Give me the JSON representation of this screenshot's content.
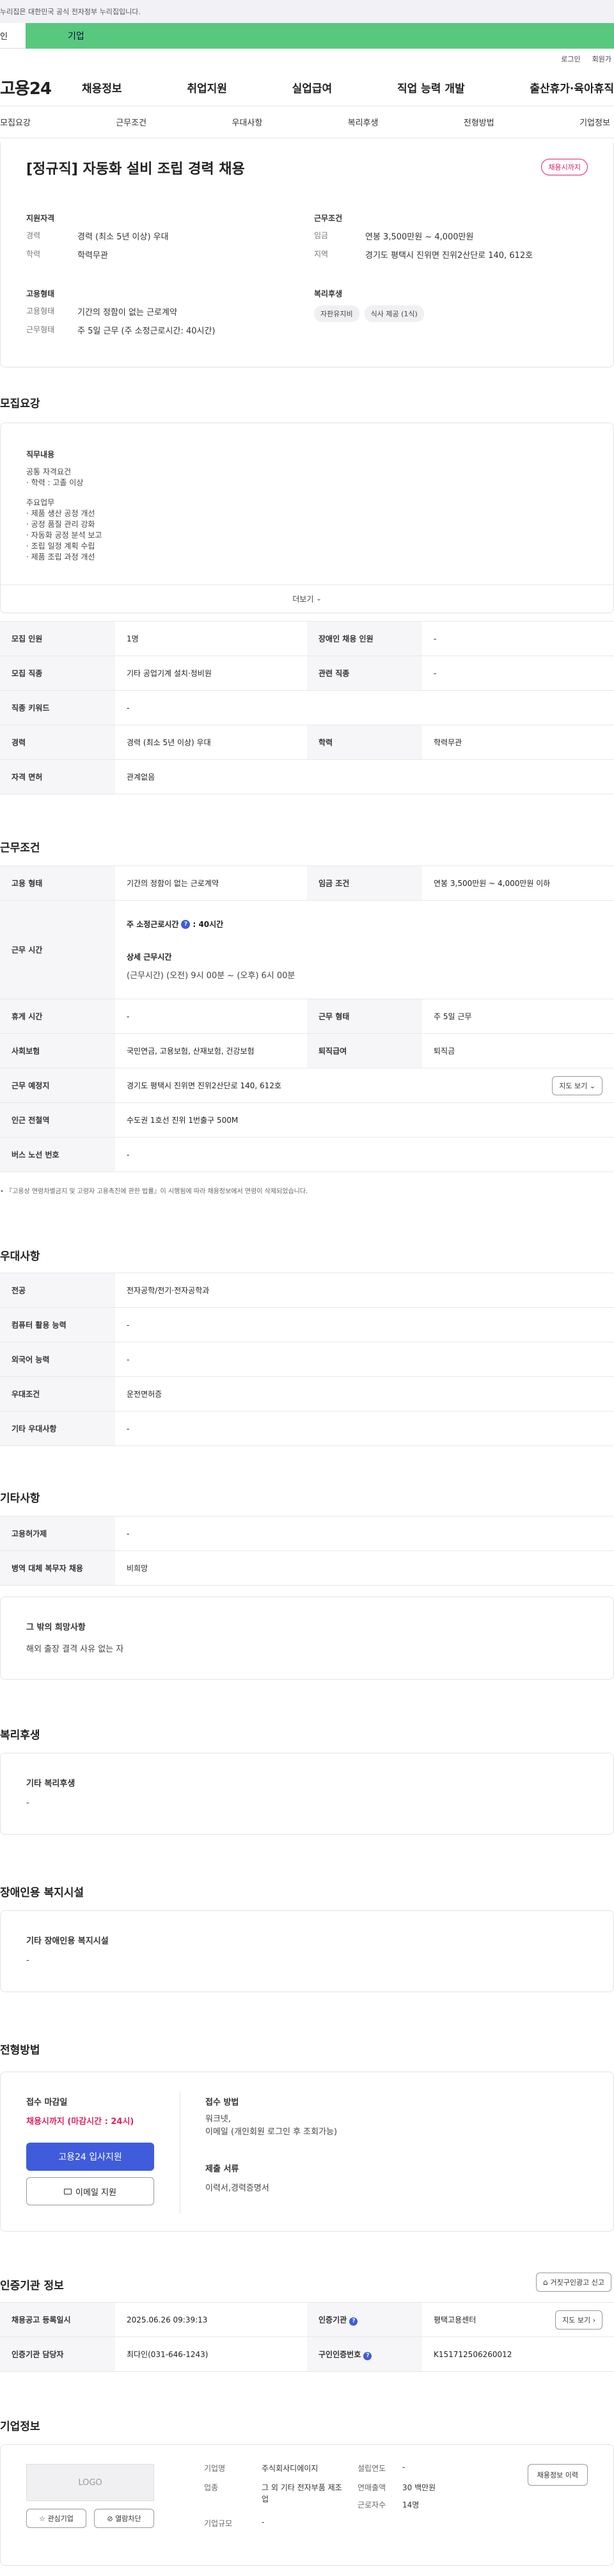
{
  "gov_notice": "누리집은 대한민국 공식 전자정부 누리집입니다.",
  "tabs": {
    "individual": "인",
    "business": "기업"
  },
  "util": {
    "login": "로그인",
    "signup": "회원가"
  },
  "logo": "고용24",
  "gnb": [
    "채용정보",
    "취업지원",
    "실업급여",
    "직업 능력 개발",
    "출산휴가·육아휴직"
  ],
  "subnav": [
    "모집요강",
    "근무조건",
    "우대사항",
    "복리후생",
    "전형방법",
    "기업정보"
  ],
  "job": {
    "title": "[정규직] 자동화 설비 조립 경력 채용",
    "deadline_badge": "채용시까지",
    "qual_title": "지원자격",
    "qual": [
      {
        "k": "경력",
        "v": "경력 (최소 5년 이상) 우대"
      },
      {
        "k": "학력",
        "v": "학력무관"
      }
    ],
    "cond_title": "근무조건",
    "cond": [
      {
        "k": "임금",
        "v": "연봉 3,500만원 ~ 4,000만원"
      },
      {
        "k": "지역",
        "v": "경기도 평택시 진위면 진위2산단로 140, 612호"
      }
    ],
    "emp_title": "고용형태",
    "emp": [
      {
        "k": "고용형태",
        "v": "기간의 정함이 없는 근로계약"
      },
      {
        "k": "근무형태",
        "v": "주 5일 근무 (주 소정근로시간: 40시간)"
      }
    ],
    "welfare_title": "복리후생",
    "welfare_chips": [
      "자판유지비",
      "식사 제공 (1식)"
    ]
  },
  "recruit": {
    "section": "모집요강",
    "duty_title": "직무내용",
    "duty_lines": [
      "공통 자격요건",
      "· 학력 : 고졸 이상",
      "",
      "주요업무",
      "· 제품 생산 공정 개선",
      "· 공정 품질 관리 강화",
      "· 자동화 공정 분석 보고",
      "· 조립 일정 계획 수립",
      "· 제품 조립 과정 개선"
    ],
    "more": "더보기",
    "rows": [
      [
        "모집 인원",
        "1명",
        "장애인 채용 인원",
        "-"
      ],
      [
        "모집 직종",
        "기타 공업기계 설치·정비원",
        "관련 직종",
        "-"
      ],
      [
        "직종 키워드",
        "-",
        "",
        ""
      ],
      [
        "경력",
        "경력 (최소 5년 이상) 우대",
        "학력",
        "학력무관"
      ],
      [
        "자격 면허",
        "관계없음",
        "",
        ""
      ]
    ]
  },
  "work": {
    "section": "근무조건",
    "emp_type_h": "고용 형태",
    "emp_type": "기간의 정함이 없는 근로계약",
    "wage_h": "임금 조건",
    "wage": "연봉 3,500만원 ~ 4,000만원 이하",
    "hours_h": "근무 시간",
    "hours_main": "주 소정근로시간",
    "hours_main_val": ": 40시간",
    "hours_detail_title": "상세 근무시간",
    "hours_detail": "(근무시간) (오전) 9시 00분 ~ (오후) 6시 00분",
    "rest_h": "휴게 시간",
    "rest": "-",
    "form_h": "근무 형태",
    "form": "주 5일 근무",
    "ins_h": "사회보험",
    "ins": "국민연금, 고용보험, 산재보험, 건강보험",
    "sev_h": "퇴직급여",
    "sev": "퇴직금",
    "place_h": "근무 예정지",
    "place": "경기도 평택시 진위면 진위2산단로 140, 612호",
    "map_btn": "지도 보기",
    "subway_h": "인근 전철역",
    "subway": "수도권 1호선 진위 1번출구 500M",
    "bus_h": "버스 노선 번호",
    "bus": "-",
    "note": "『고용상 연령차별금지 및 고령자 고용촉진에 관한 법률』이 시행됨에 따라 채용정보에서 연령이 삭제되었습니다."
  },
  "pref": {
    "section": "우대사항",
    "rows": [
      [
        "전공",
        "전자공학/전기·전자공학과"
      ],
      [
        "컴퓨터 활용 능력",
        "-"
      ],
      [
        "외국어 능력",
        "-"
      ],
      [
        "우대조건",
        "운전면허증"
      ],
      [
        "기타 우대사항",
        "-"
      ]
    ]
  },
  "etc": {
    "section": "기타사항",
    "rows": [
      [
        "고용허가제",
        "-"
      ],
      [
        "병역 대체 복무자 채용",
        "비희망"
      ]
    ],
    "hope_title": "그 밖의 희망사항",
    "hope_text": "해외 출장 결격 사유 없는 자"
  },
  "benefit": {
    "section": "복리후생",
    "title": "기타 복리후생",
    "text": "-"
  },
  "disabled": {
    "section": "장애인용 복지시설",
    "title": "기타 장애인용 복지시설",
    "text": "-"
  },
  "select": {
    "section": "전형방법",
    "deadline_title": "접수 마감일",
    "deadline": "채용시까지 (마감시간 : 24시)",
    "apply_btn": "고용24 입사지원",
    "email_btn": "이메일 지원",
    "method_title": "접수 방법",
    "method": "워크넷,",
    "method2": "이메일 (개인회원 로그인 후 조회가능)",
    "docs_title": "제출 서류",
    "docs": "이력서,경력증명서"
  },
  "agency": {
    "section": "인증기관 정보",
    "report_btn": "거짓구인광고 신고",
    "reg_h": "채용공고 등록일시",
    "reg": "2025.06.26 09:39:13",
    "org_h": "인증기관",
    "org": "평택고용센터",
    "map_btn": "지도 보기",
    "mgr_h": "인증기관 담당자",
    "mgr": "최다인(031-646-1243)",
    "num_h": "구인인증번호",
    "num": "K151712506260012"
  },
  "company": {
    "section": "기업정보",
    "logo_ph": "LOGO",
    "interest_btn": "관심기업",
    "block_btn": "열람차단",
    "history_btn": "채용정보 이력",
    "name_k": "기업명",
    "name": "주식회사디에이지",
    "biz_k": "업종",
    "biz": "그 외 기타 전자부품 제조업",
    "size_k": "기업규모",
    "size": "-",
    "year_k": "설립연도",
    "year": "-",
    "sales_k": "연매출액",
    "sales": "30 백만원",
    "staff_k": "근로자수",
    "staff": "14명"
  },
  "colors": {
    "accent": "#3f5cdc",
    "biz_tab": "#58c87e",
    "deadline": "#e0245e"
  }
}
